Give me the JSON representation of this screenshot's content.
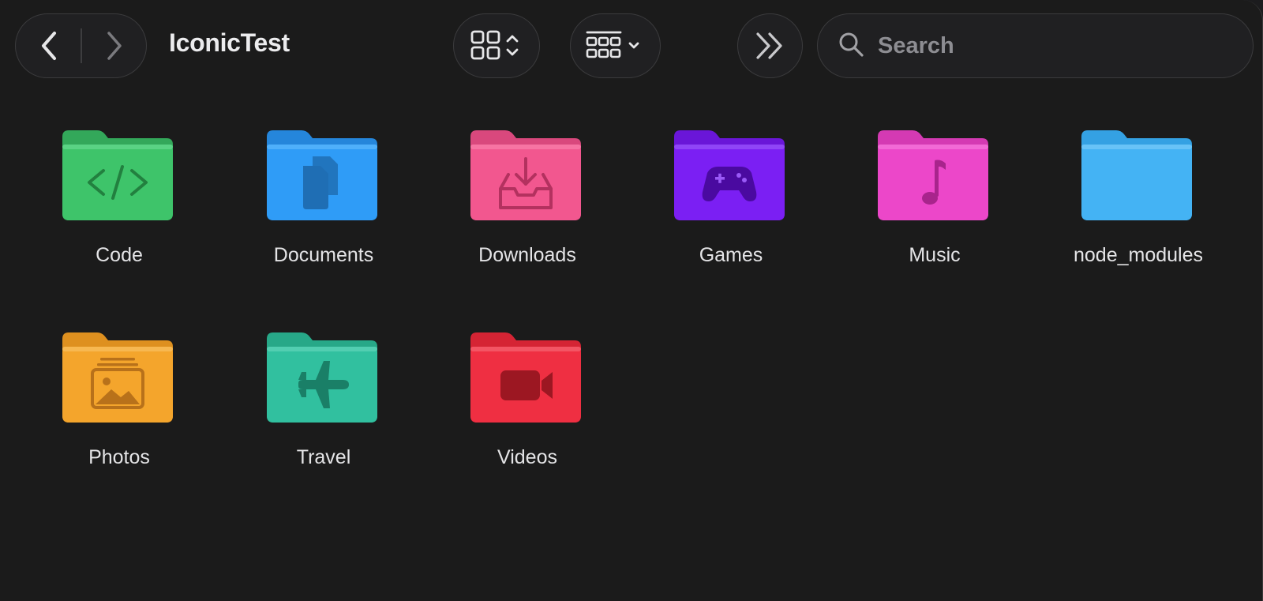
{
  "window": {
    "title": "IconicTest"
  },
  "toolbar": {
    "search_placeholder": "Search",
    "search_value": ""
  },
  "icons": {
    "back": "chevron-left-icon",
    "forward": "chevron-right-icon",
    "view": "grid-view-icon",
    "group": "group-by-icon",
    "more": "double-chevron-right-icon",
    "search": "magnifying-glass-icon"
  },
  "folders": [
    {
      "name": "Code",
      "color": "#3ec46a",
      "emblem": "code-icon"
    },
    {
      "name": "Documents",
      "color": "#2f9cf7",
      "emblem": "documents-icon"
    },
    {
      "name": "Downloads",
      "color": "#f2578f",
      "emblem": "download-tray-icon"
    },
    {
      "name": "Games",
      "color": "#7b1ff3",
      "emblem": "gamepad-icon"
    },
    {
      "name": "Music",
      "color": "#ec47c9",
      "emblem": "music-note-icon"
    },
    {
      "name": "node_modules",
      "color": "#44b3f4",
      "emblem": ""
    },
    {
      "name": "Photos",
      "color": "#f4a52c",
      "emblem": "photos-icon"
    },
    {
      "name": "Travel",
      "color": "#31c09f",
      "emblem": "airplane-icon"
    },
    {
      "name": "Videos",
      "color": "#ef2f42",
      "emblem": "video-camera-icon"
    }
  ]
}
